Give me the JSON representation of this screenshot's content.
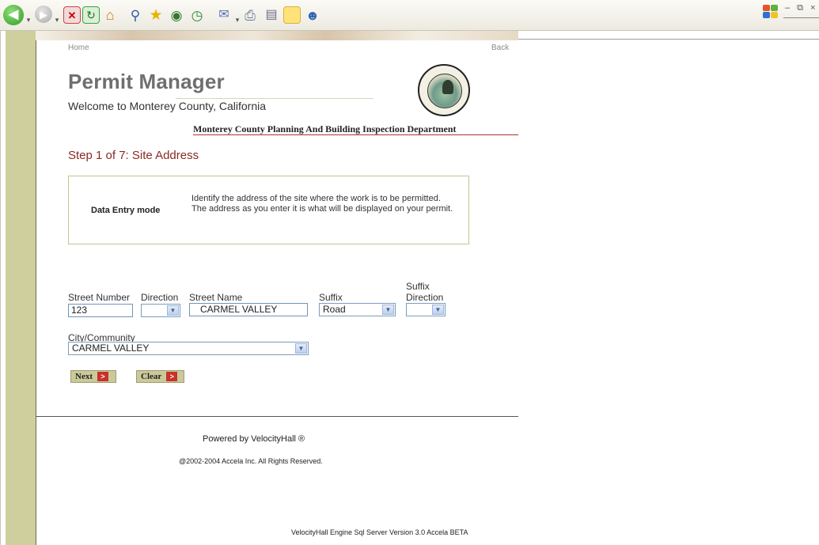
{
  "toolbar": {
    "icons": [
      "back-icon",
      "forward-icon",
      "stop-icon",
      "refresh-icon",
      "home-icon",
      "search-icon",
      "favorites-icon",
      "media-icon",
      "history-icon",
      "mail-icon",
      "print-icon",
      "edit-icon",
      "note-icon",
      "messenger-icon"
    ],
    "window_controls": "– ⧉ ×"
  },
  "nav": {
    "home": "Home",
    "back": "Back"
  },
  "header": {
    "title": "Permit Manager",
    "welcome": "Welcome to Monterey County, California",
    "department": "Monterey County Planning And Building Inspection Department"
  },
  "step": {
    "title": "Step 1 of 7: Site Address"
  },
  "info": {
    "mode": "Data Entry mode",
    "description": "Identify the address of the site where the work is to be permitted. The address as you enter it is what will be displayed on your permit."
  },
  "form": {
    "street_number": {
      "label": "Street Number",
      "value": "123"
    },
    "direction": {
      "label": "Direction",
      "value": ""
    },
    "street_name": {
      "label": "Street Name",
      "value": "CARMEL VALLEY"
    },
    "suffix": {
      "label": "Suffix",
      "value": "Road"
    },
    "suffix_direction": {
      "label_line1": "Suffix",
      "label_line2": "Direction",
      "value": ""
    },
    "city": {
      "label": "City/Community",
      "value": "CARMEL VALLEY"
    }
  },
  "buttons": {
    "next": "Next",
    "clear": "Clear"
  },
  "footer": {
    "powered": "Powered by  VelocityHall ®",
    "copyright": "@2002-2004 Accela Inc. All Rights Reserved.",
    "engine": "VelocityHall Engine Sql Server Version 3.0 Accela BETA"
  },
  "colors": {
    "sidebar": "#cfcf9d",
    "step_title": "#8b2a23",
    "accent_rule": "#b23030",
    "button": "#cbc99a",
    "button_arrow": "#c8322a"
  }
}
